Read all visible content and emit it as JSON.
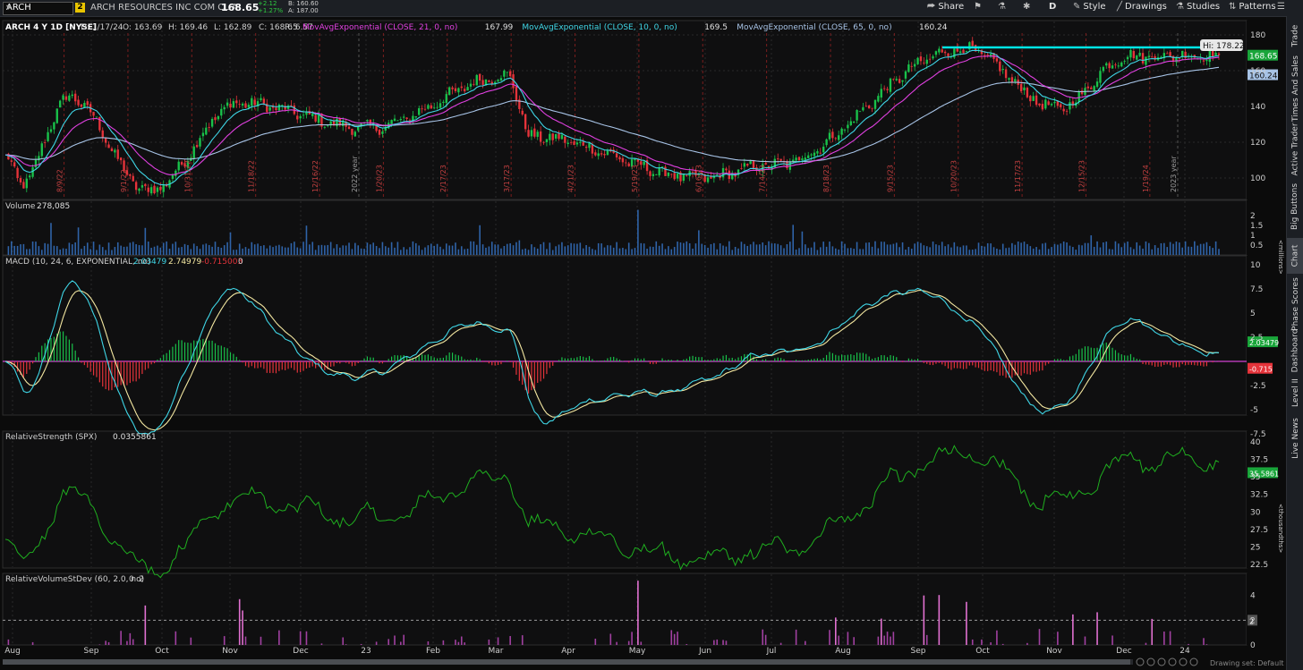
{
  "topbar": {
    "symbol": "ARCH",
    "link_badge": "2",
    "company": "ARCH RESOURCES INC COM CL A",
    "last": "168.65",
    "change": "+2.12",
    "change_pct": "+1.27%",
    "bid": "B: 160.60",
    "ask": "A: 187.00",
    "buttons": {
      "share": "Share",
      "style": "Style",
      "drawings": "Drawings",
      "studies": "Studies",
      "patterns": "Patterns",
      "period": "D"
    }
  },
  "price_panel": {
    "title": "ARCH 4 Y 1D [NYSE]",
    "ohlc": {
      "d": "D: 1/17/24",
      "o": "O: 163.69",
      "h": "H: 169.46",
      "l": "L: 162.89",
      "c": "C: 168.65",
      "r": "R: 6.57"
    },
    "studies": [
      {
        "label": "MovAvgExponential (CLOSE, 21, 0, no)",
        "value": "167.99",
        "color": "#e040e0"
      },
      {
        "label": "MovAvgExponential (CLOSE, 10, 0, no)",
        "value": "169.5",
        "color": "#3fd6e6"
      },
      {
        "label": "MovAvgExponential (CLOSE, 65, 0, no)",
        "value": "160.24",
        "color": "#a7c3e6"
      }
    ],
    "hi_label": "Hi: 178.22",
    "last_badge": "168.65",
    "ema65_badge": "160.24",
    "y_ticks": [
      "180",
      "160",
      "140",
      "120",
      "100"
    ],
    "vertical_dates": [
      "8/9/22",
      "9/1/22",
      "10/31/22",
      "11/18/22",
      "12/16/22",
      "2022 year",
      "1/20/23",
      "2/17/23",
      "3/17/23",
      "4/21/23",
      "5/19/23",
      "6/16/23",
      "7/14/23",
      "8/18/23",
      "9/15/23",
      "10/20/23",
      "11/17/23",
      "12/15/23",
      "2023 year",
      "1/19/24"
    ]
  },
  "volume_panel": {
    "title": "Volume",
    "value": "278,085",
    "y_ticks": [
      "2",
      "1.5",
      "1",
      "0.5"
    ],
    "unit": "<millions>"
  },
  "macd_panel": {
    "title": "MACD (10, 24, 6, EXPONENTIAL, no)",
    "v1": "2.03479",
    "v2": "2.74979",
    "v3": "-0.715003",
    "v4": "0",
    "y_ticks": [
      "10",
      "7.5",
      "5",
      "2.5",
      "-2.5",
      "-5",
      "-7.5"
    ],
    "badge_macd": "2.03479",
    "badge_diff": "-0.715"
  },
  "rs_panel": {
    "title": "RelativeStrength (SPX)",
    "value": "0.0355861",
    "y_ticks": [
      "40",
      "37.5",
      "35",
      "32.5",
      "30",
      "27.5",
      "25",
      "22.5"
    ],
    "badge": "35.5861",
    "unit": "<thousandths>"
  },
  "rv_panel": {
    "title": "RelativeVolumeStDev (60, 2.0, no)",
    "v1": "0",
    "v2": "2",
    "y_ticks": [
      "4",
      "2",
      "0"
    ],
    "badge": "2"
  },
  "x_axis": [
    "Aug",
    "Sep",
    "Oct",
    "Nov",
    "Dec",
    "23",
    "Feb",
    "Mar",
    "Apr",
    "May",
    "Jun",
    "Jul",
    "Aug",
    "Sep",
    "Oct",
    "Nov",
    "Dec",
    "24"
  ],
  "footer": {
    "drawing_set": "Drawing set: Default"
  },
  "sidebar_tabs": [
    "Trade",
    "Times And Sales",
    "Active Trader",
    "Big Buttons",
    "Chart",
    "Phase Scores",
    "Dashboard",
    "Level II",
    "Live News"
  ],
  "colors": {
    "bull": "#19c24a",
    "bear": "#e5333a",
    "ema10": "#3fd6e6",
    "ema21": "#e040e0",
    "ema65": "#a7c3e6",
    "resistance": "#00e5e5",
    "volume": "#2f63a8",
    "rs": "#1fae1f",
    "rv": "#e070d0"
  },
  "chart_data": {
    "type": "candlestick",
    "x_range": [
      "2022-07-25",
      "2024-01-17"
    ],
    "ylim": [
      88,
      188
    ],
    "key_closes": [
      {
        "date": "2022-08-01",
        "close": 97
      },
      {
        "date": "2022-08-23",
        "close": 145
      },
      {
        "date": "2022-09-27",
        "close": 93
      },
      {
        "date": "2022-11-07",
        "close": 142
      },
      {
        "date": "2023-01-03",
        "close": 128
      },
      {
        "date": "2023-03-06",
        "close": 157
      },
      {
        "date": "2023-03-17",
        "close": 123
      },
      {
        "date": "2023-05-31",
        "close": 100
      },
      {
        "date": "2023-06-30",
        "close": 107
      },
      {
        "date": "2023-09-25",
        "close": 172
      },
      {
        "date": "2023-11-06",
        "close": 139
      },
      {
        "date": "2023-12-07",
        "close": 168
      },
      {
        "date": "2024-01-17",
        "close": 168.65
      }
    ],
    "resistance_level": 173,
    "hi": 178.22,
    "ema": [
      {
        "name": "EMA 10",
        "last": 169.5
      },
      {
        "name": "EMA 21",
        "last": 167.99
      },
      {
        "name": "EMA 65",
        "last": 160.24
      }
    ]
  }
}
